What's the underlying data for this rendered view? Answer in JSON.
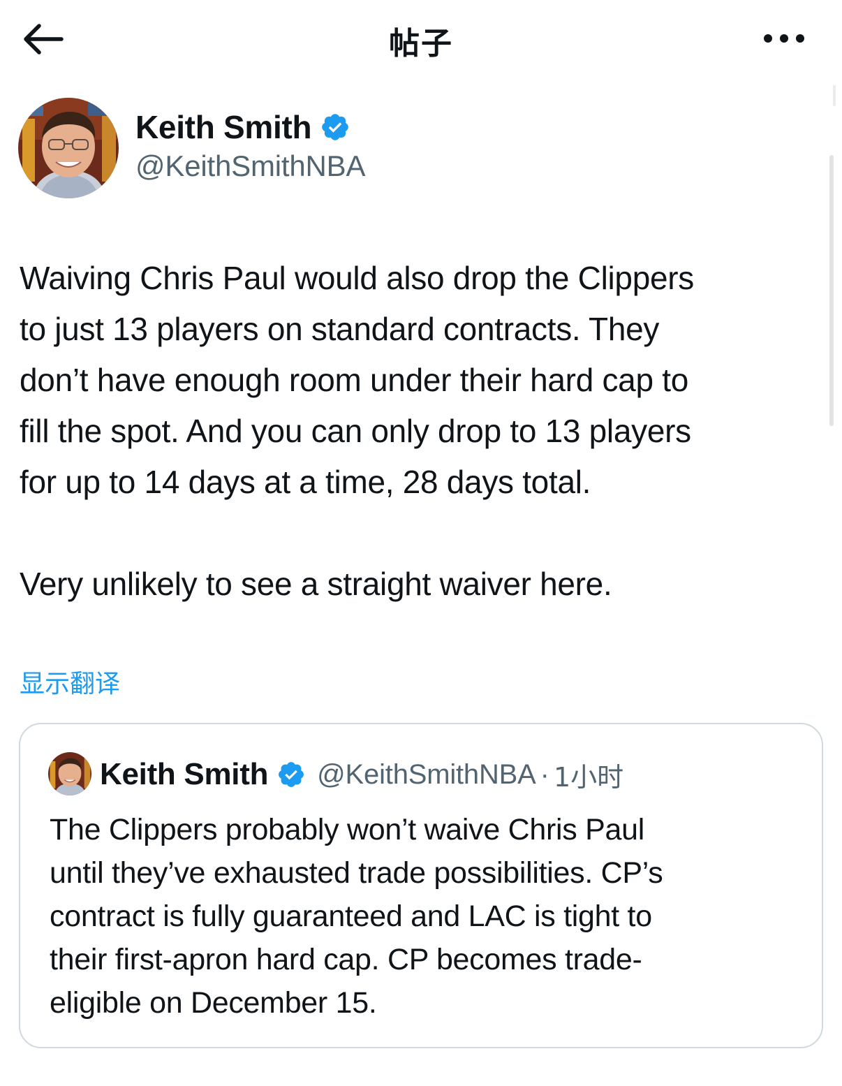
{
  "header": {
    "title": "帖子",
    "back_icon": "arrow-left-icon",
    "more_icon": "more-horizontal-icon"
  },
  "tweet": {
    "author": {
      "name": "Keith Smith",
      "handle": "@KeithSmithNBA",
      "verified": true
    },
    "text_lines": [
      "Waiving Chris Paul would also drop the Clippers",
      "to just 13 players on standard contracts. They",
      "don’t have enough room under their hard cap to",
      "fill the spot. And you can only drop to 13 players",
      "for up to 14 days at a time, 28 days total."
    ],
    "text_line2": "Very unlikely to see a straight waiver here.",
    "translate_label": "显示翻译"
  },
  "quote": {
    "author": {
      "name": "Keith Smith",
      "handle": "@KeithSmithNBA",
      "verified": true
    },
    "separator": "·",
    "time": "1小时",
    "text_lines": [
      "The Clippers probably won’t waive Chris Paul",
      "until they’ve exhausted trade possibilities. CP’s",
      "contract is fully guaranteed and LAC is tight to",
      "their first-apron hard cap. CP becomes trade-",
      "eligible on December 15."
    ]
  },
  "colors": {
    "text": "#0f1419",
    "secondary": "#536471",
    "accent": "#1d9bf0",
    "border": "#cfd9de"
  }
}
